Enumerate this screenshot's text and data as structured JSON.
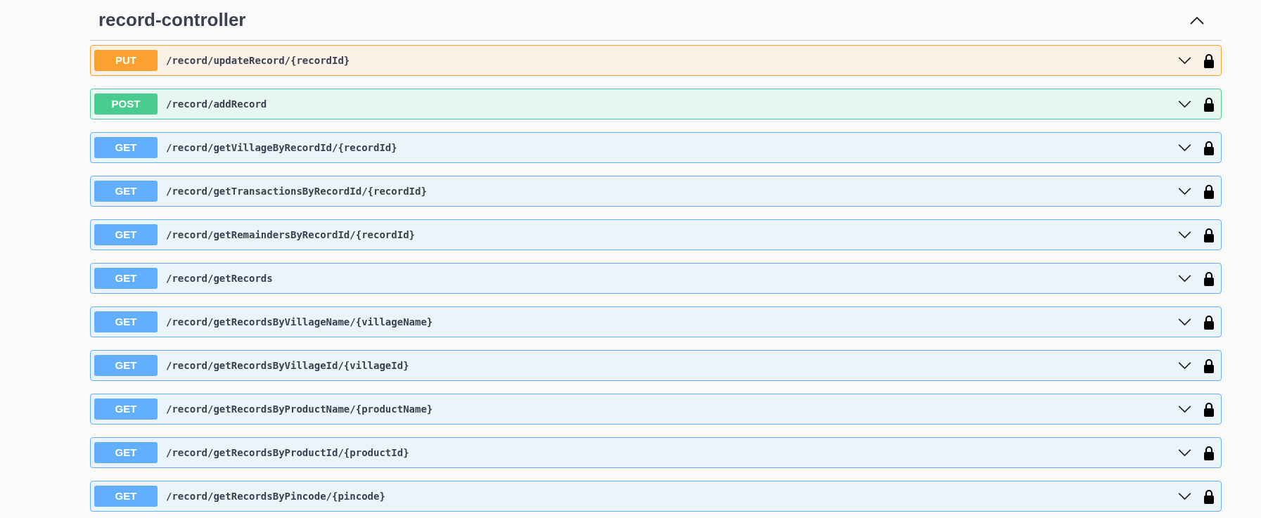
{
  "section": {
    "title": "record-controller",
    "expanded": true
  },
  "operations": [
    {
      "method": "PUT",
      "kind": "put",
      "path": "/record/updateRecord/{recordId}",
      "expanded": false,
      "locked": true
    },
    {
      "method": "POST",
      "kind": "post",
      "path": "/record/addRecord",
      "expanded": false,
      "locked": true
    },
    {
      "method": "GET",
      "kind": "get",
      "path": "/record/getVillageByRecordId/{recordId}",
      "expanded": false,
      "locked": true
    },
    {
      "method": "GET",
      "kind": "get",
      "path": "/record/getTransactionsByRecordId/{recordId}",
      "expanded": false,
      "locked": true
    },
    {
      "method": "GET",
      "kind": "get",
      "path": "/record/getRemaindersByRecordId/{recordId}",
      "expanded": false,
      "locked": true
    },
    {
      "method": "GET",
      "kind": "get",
      "path": "/record/getRecords",
      "expanded": false,
      "locked": true
    },
    {
      "method": "GET",
      "kind": "get",
      "path": "/record/getRecordsByVillageName/{villageName}",
      "expanded": false,
      "locked": true
    },
    {
      "method": "GET",
      "kind": "get",
      "path": "/record/getRecordsByVillageId/{villageId}",
      "expanded": false,
      "locked": true
    },
    {
      "method": "GET",
      "kind": "get",
      "path": "/record/getRecordsByProductName/{productName}",
      "expanded": false,
      "locked": true
    },
    {
      "method": "GET",
      "kind": "get",
      "path": "/record/getRecordsByProductId/{productId}",
      "expanded": false,
      "locked": true
    },
    {
      "method": "GET",
      "kind": "get",
      "path": "/record/getRecordsByPincode/{pincode}",
      "expanded": false,
      "locked": true
    }
  ]
}
